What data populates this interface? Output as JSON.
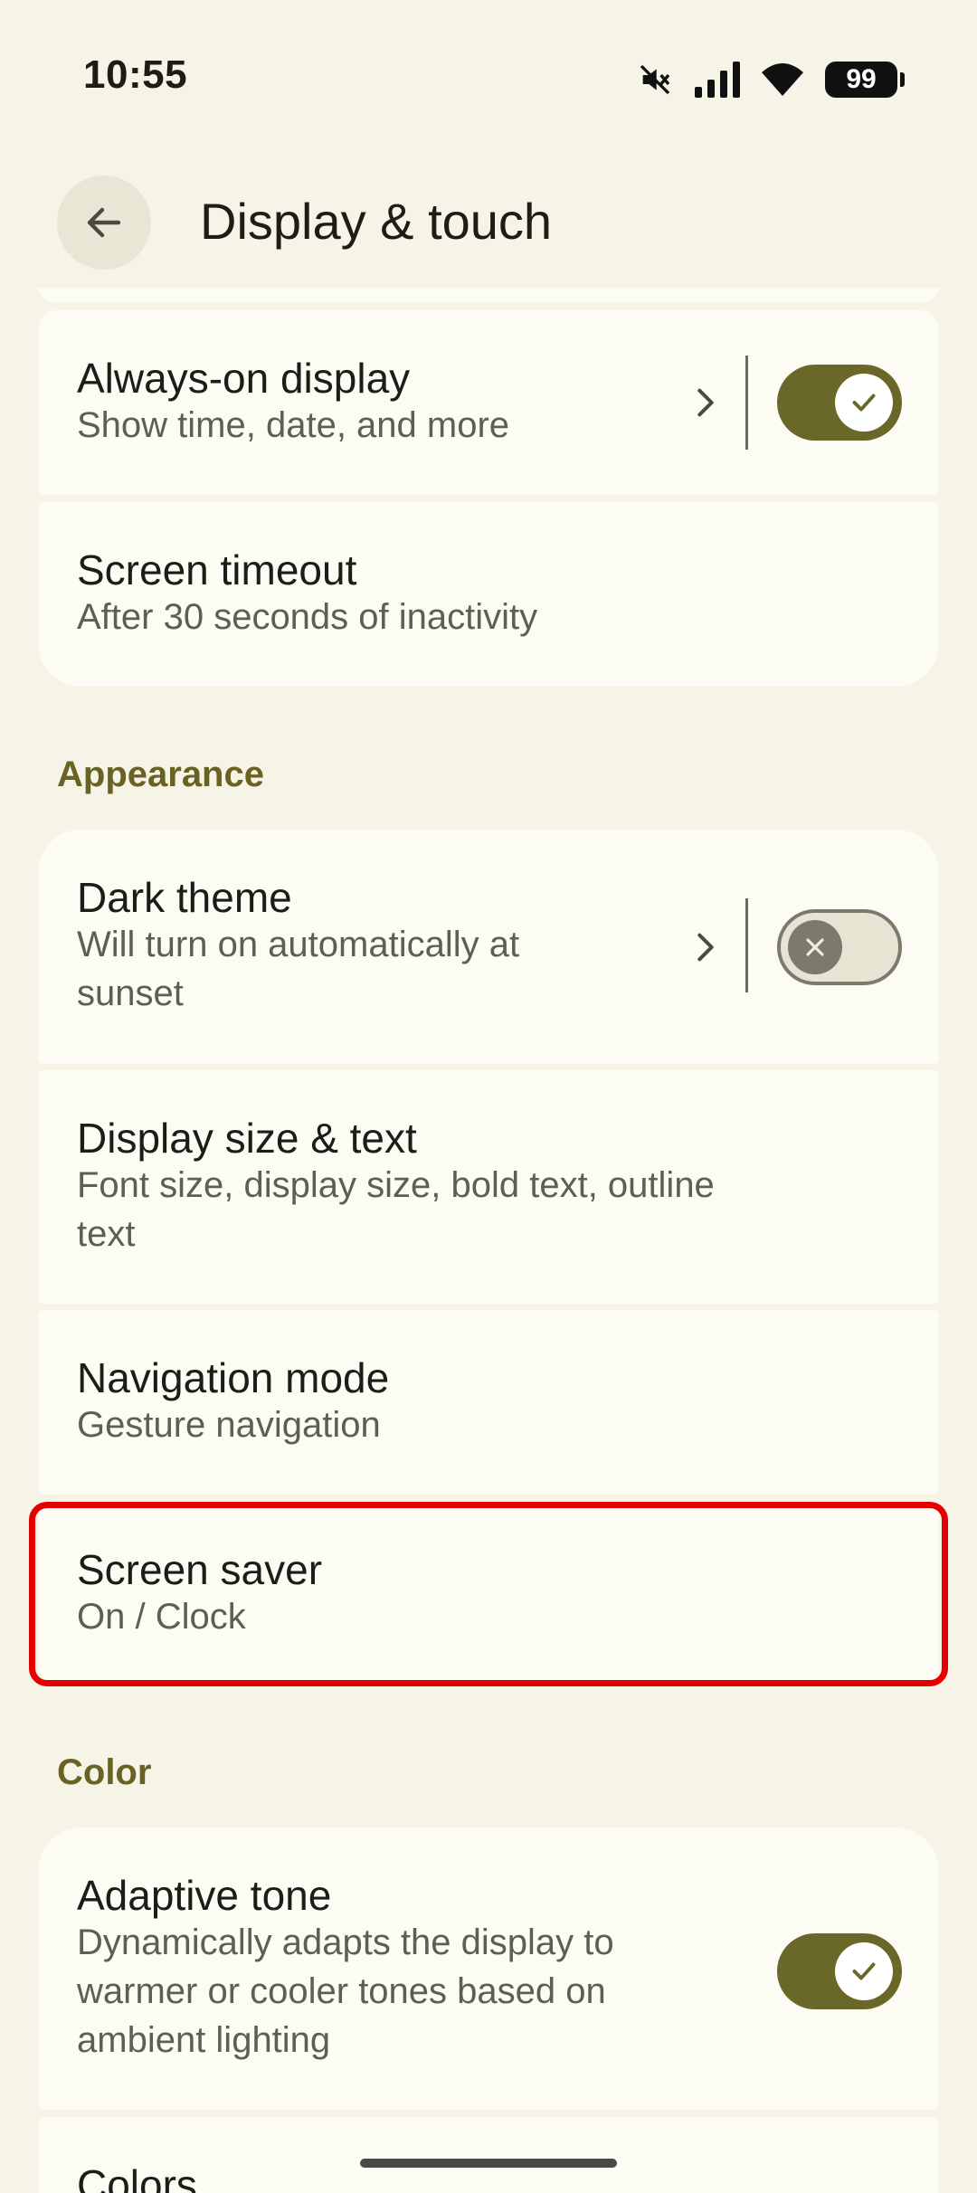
{
  "status_bar": {
    "time": "10:55",
    "battery": "99",
    "icons": [
      "mute-icon",
      "signal-icon",
      "wifi-icon",
      "battery-icon"
    ]
  },
  "header": {
    "title": "Display & touch"
  },
  "lock_card": {
    "always_on": {
      "title": "Always-on display",
      "subtitle": "Show time, date, and more",
      "enabled": true
    },
    "screen_timeout": {
      "title": "Screen timeout",
      "subtitle": "After 30 seconds of inactivity"
    }
  },
  "appearance": {
    "section_title": "Appearance",
    "dark_theme": {
      "title": "Dark theme",
      "subtitle_line1": "Will turn on automatically at",
      "subtitle_line2": "sunset",
      "enabled": false
    },
    "display_size": {
      "title": "Display size & text",
      "subtitle_line1": "Font size, display size, bold text, outline",
      "subtitle_line2": "text"
    },
    "navigation": {
      "title": "Navigation mode",
      "subtitle": "Gesture navigation"
    },
    "screen_saver": {
      "title": "Screen saver",
      "subtitle": "On / Clock"
    }
  },
  "color": {
    "section_title": "Color",
    "adaptive_tone": {
      "title": "Adaptive tone",
      "subtitle_line1": "Dynamically adapts the display to",
      "subtitle_line2": "warmer or cooler tones based on",
      "subtitle_line3": "ambient lighting",
      "enabled": true
    },
    "colors": {
      "title": "Colors"
    }
  },
  "colors": {
    "background": "#f6f4e7",
    "card": "#fdfcf4",
    "accent": "#6a6828",
    "section_text": "#6a6222",
    "highlight": "#e30000"
  }
}
